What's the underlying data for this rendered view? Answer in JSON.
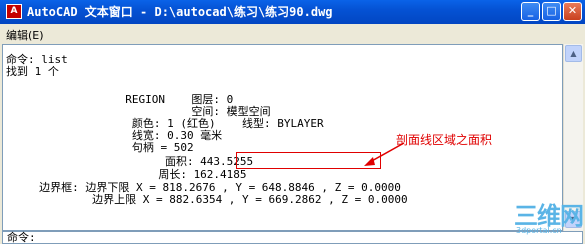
{
  "window": {
    "icon_label": "A",
    "title": "AutoCAD 文本窗口 - D:\\autocad\\练习\\练习90.dwg",
    "buttons": {
      "minimize": "_",
      "maximize": "□",
      "close": "✕"
    }
  },
  "menu": {
    "edit": "编辑(E)"
  },
  "text_lines": [
    "命令: list",
    "找到 1 个",
    "                  REGION    图层: 0",
    "                            空间: 模型空间",
    "                   颜色: 1 (红色)    线型: BYLAYER",
    "                   线宽: 0.30 毫米",
    "                   句柄 = 502",
    "                        面积: 443.5255",
    "                       周长: 162.4185",
    "     边界框: 边界下限 X = 818.2676 , Y = 648.8846 , Z = 0.0000",
    "             边界上限 X = 882.6354 , Y = 669.2862 , Z = 0.0000"
  ],
  "command_prompt": "命令:",
  "annotation": "剖面线区域之面积",
  "watermark": {
    "main": "三维网",
    "sub": "3dportal.cn"
  },
  "colors": {
    "highlight": "#e00000",
    "title_bar": "#0552d4"
  }
}
